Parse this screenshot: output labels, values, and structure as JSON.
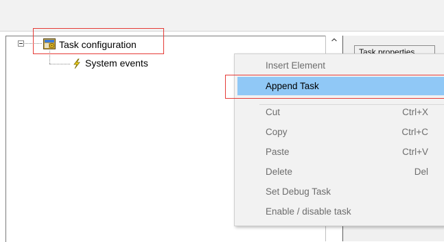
{
  "tree": {
    "root_label": "Task configuration",
    "child_label": "System events"
  },
  "right_panel": {
    "tab_label": "Task properties"
  },
  "context_menu": {
    "items": [
      {
        "label": "Insert Element",
        "shortcut": ""
      },
      {
        "label": "Append Task",
        "shortcut": ""
      },
      {
        "label": "Cut",
        "shortcut": "Ctrl+X"
      },
      {
        "label": "Copy",
        "shortcut": "Ctrl+C"
      },
      {
        "label": "Paste",
        "shortcut": "Ctrl+V"
      },
      {
        "label": "Delete",
        "shortcut": "Del"
      },
      {
        "label": "Set Debug Task",
        "shortcut": ""
      },
      {
        "label": "Enable / disable task",
        "shortcut": ""
      }
    ],
    "highlighted": "Append Task"
  },
  "colors": {
    "highlight": "#90c8f6",
    "annotation_red": "#e53935"
  },
  "icons": {
    "root": "task-config-icon",
    "child": "lightning-icon",
    "expander": "collapse-minus-icon",
    "scroll": "scroll-up-arrow-icon"
  }
}
